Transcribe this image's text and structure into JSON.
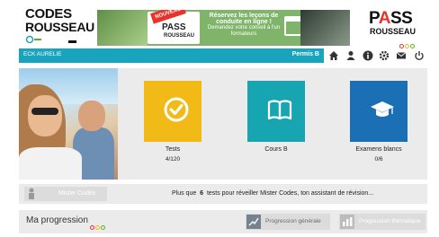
{
  "header": {
    "logo_line1": "CODES",
    "logo_line2": "ROUSSEAU",
    "banner": {
      "badge": "NOUVEAU",
      "pass": "PASS",
      "rousseau": "ROUSSEAU",
      "headline": "Réservez les leçons de conduite en ligne !",
      "subline": "Demandez votre conseil à l'un formateurs"
    },
    "pass_logo": {
      "p1": "P",
      "a": "A",
      "ss": "SS",
      "rousseau": "ROUSSEAU"
    }
  },
  "navbar": {
    "user": "ECK AURELIE",
    "permis": "Permis B",
    "icons": [
      "home-icon",
      "user-icon",
      "info-icon",
      "gear-icon",
      "mail-icon",
      "power-icon"
    ]
  },
  "tiles": [
    {
      "label": "Tests",
      "sub": "4/120",
      "color": "#f2ba17",
      "icon": "checkmark-icon"
    },
    {
      "label": "Cours B",
      "sub": "",
      "color": "#18a5b2",
      "icon": "book-icon"
    },
    {
      "label": "Examens blancs",
      "sub": "0/6",
      "color": "#1a6fb5",
      "icon": "graduation-cap-icon"
    }
  ],
  "hint_bar": {
    "button_label": "Mister Codes",
    "text_before": "Plus que",
    "count": "6",
    "text_after": "tests pour réveiller Mister Codes, ton assistant de révision..."
  },
  "progression": {
    "label": "Ma progression",
    "buttons": [
      {
        "label": "Progression générale",
        "icon": "chart-icon"
      },
      {
        "label": "Progression thématique",
        "icon": "bar-chart-icon"
      }
    ]
  },
  "colors": {
    "teal": "#1aa3bd",
    "red": "#e7332b",
    "yellow": "#f2ba17",
    "blue": "#1a6fb5"
  }
}
